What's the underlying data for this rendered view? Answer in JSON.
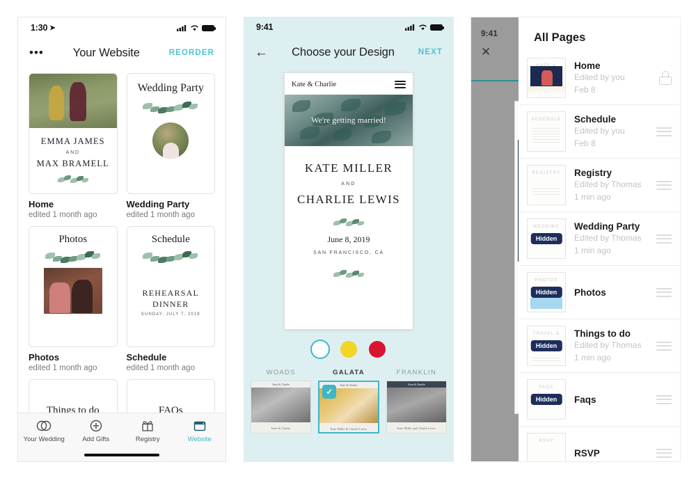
{
  "phone1": {
    "status": {
      "time": "1:30",
      "location_arrow": "➤"
    },
    "nav": {
      "menu_icon": "•••",
      "title": "Your Website",
      "action": "REORDER"
    },
    "cards": [
      {
        "title": "Home",
        "subtitle": "edited 1 month ago",
        "art": "home",
        "name_line1": "EMMA JAMES",
        "and": "AND",
        "name_line2": "MAX BRAMELL"
      },
      {
        "title": "Wedding Party",
        "subtitle": "edited 1 month ago",
        "art": "wedding-party",
        "heading": "Wedding Party"
      },
      {
        "title": "Photos",
        "subtitle": "edited 1 month ago",
        "art": "photos",
        "heading": "Photos"
      },
      {
        "title": "Schedule",
        "subtitle": "edited 1 month ago",
        "art": "schedule",
        "heading": "Schedule",
        "event1": "REHEARSAL",
        "event2": "DINNER",
        "event_date": "SUNDAY, JULY 7, 2019"
      }
    ],
    "partial_cards": [
      {
        "heading": "Things to do"
      },
      {
        "heading": "FAQs"
      }
    ],
    "tabs": [
      {
        "label": "Your Wedding",
        "icon": "rings-icon",
        "active": false
      },
      {
        "label": "Add Gifts",
        "icon": "plus-circle-icon",
        "active": false
      },
      {
        "label": "Registry",
        "icon": "gift-icon",
        "active": false
      },
      {
        "label": "Website",
        "icon": "browser-icon",
        "active": true
      }
    ]
  },
  "phone2": {
    "status": {
      "time": "9:41"
    },
    "nav": {
      "back_icon": "←",
      "title": "Choose your Design",
      "action": "NEXT"
    },
    "preview": {
      "brand": "Kate & Charlie",
      "menu_icon": "hamburger-icon",
      "hero_text": "We're getting married!",
      "name1": "KATE MILLER",
      "and": "AND",
      "name2": "CHARLIE LEWIS",
      "date": "June 8, 2019",
      "city": "SAN FRANCISCO, CA"
    },
    "colors": [
      {
        "name": "white",
        "hex": "#ffffff",
        "selected": true
      },
      {
        "name": "yellow",
        "hex": "#f2d526",
        "selected": false
      },
      {
        "name": "red",
        "hex": "#d81430",
        "selected": false
      }
    ],
    "accent": "#3fb6c6",
    "themes": [
      {
        "name": "WOADS",
        "selected": false,
        "brand": "Kate & Charlie",
        "foot": "Kate & Charlie"
      },
      {
        "name": "GALATA",
        "selected": true,
        "brand": "Kate & Charlie",
        "foot": "Kate Miller & Charlie Lewis",
        "check": "✓"
      },
      {
        "name": "FRANKLIN",
        "selected": false,
        "brand": "Kate & Charlie",
        "foot": "Kate Miller and Charlie Lewis"
      }
    ]
  },
  "phone3": {
    "status": {
      "time": "9:41"
    },
    "close_icon": "✕",
    "title": "All Pages",
    "rows": [
      {
        "title": "Home",
        "sub1": "Edited by you",
        "sub2": "Feb 8",
        "hidden": false,
        "trailing": "lock-icon",
        "art": "home"
      },
      {
        "title": "Schedule",
        "sub1": "Edited by you",
        "sub2": "Feb 8",
        "hidden": false,
        "trailing": "drag-handle",
        "art": "schedule",
        "ghost": "SCHEDULE"
      },
      {
        "title": "Registry",
        "sub1": "Edited by Thomas",
        "sub2": "1 min ago",
        "hidden": false,
        "trailing": "drag-handle",
        "art": "registry",
        "ghost": "REGISTRY"
      },
      {
        "title": "Wedding Party",
        "sub1": "Edited by Thomas",
        "sub2": "1 min ago",
        "hidden": true,
        "hidden_label": "Hidden",
        "trailing": "drag-handle",
        "art": "plain",
        "ghost": "WEDDING"
      },
      {
        "title": "Photos",
        "sub1": "",
        "sub2": "",
        "hidden": true,
        "hidden_label": "Hidden",
        "trailing": "drag-handle",
        "art": "sky",
        "ghost": "PHOTOS"
      },
      {
        "title": "Things to do",
        "sub1": "Edited by Thomas",
        "sub2": "1 min ago",
        "hidden": true,
        "hidden_label": "Hidden",
        "trailing": "drag-handle",
        "art": "plain",
        "ghost": "TRAVEL &"
      },
      {
        "title": "Faqs",
        "sub1": "",
        "sub2": "",
        "hidden": true,
        "hidden_label": "Hidden",
        "trailing": "drag-handle",
        "art": "plain",
        "ghost": "FAQS"
      },
      {
        "title": "RSVP",
        "sub1": "",
        "sub2": "",
        "hidden": false,
        "trailing": "drag-handle",
        "art": "plain",
        "ghost": "RSVP"
      }
    ]
  }
}
